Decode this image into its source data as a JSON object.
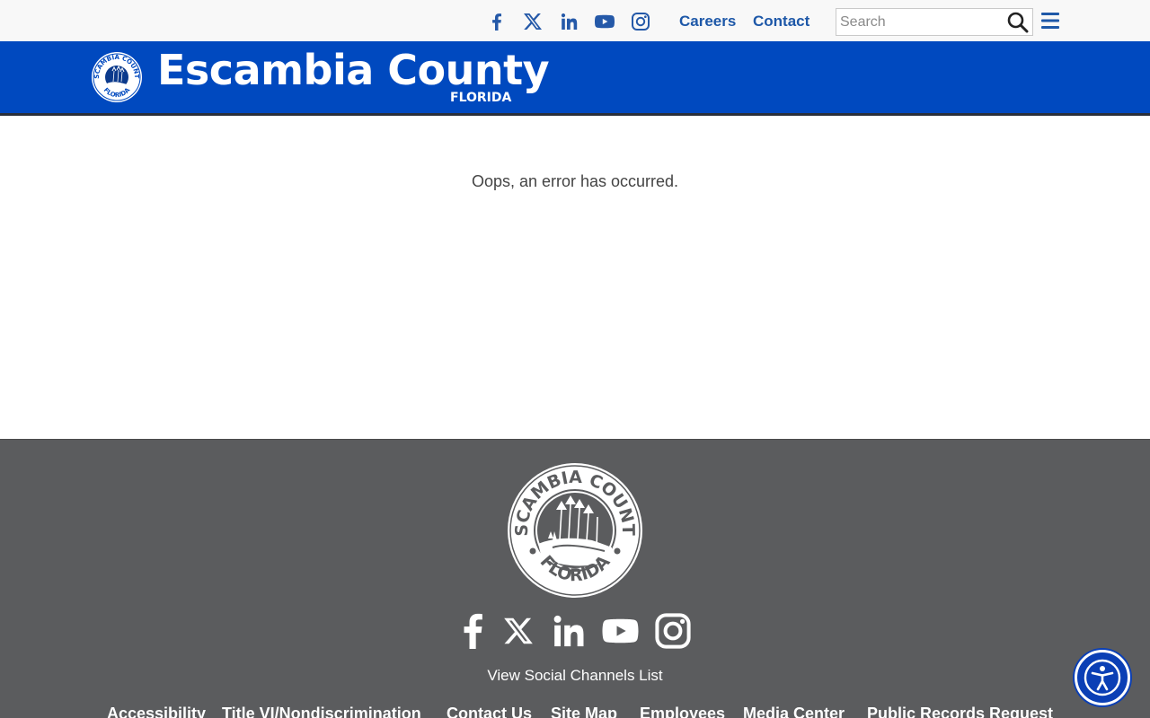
{
  "utility": {
    "social_icons": [
      "facebook-icon",
      "x-icon",
      "linkedin-icon",
      "youtube-icon",
      "instagram-icon"
    ],
    "links": [
      "Careers",
      "Contact"
    ],
    "search_placeholder": "Search"
  },
  "header": {
    "title": "Escambia County",
    "subtitle": "FLORIDA",
    "seal_text_top": "ESCAMBIA COUNTY",
    "seal_text_bottom": "FLORIDA"
  },
  "main": {
    "message": "Oops, an error has occurred."
  },
  "footer": {
    "social_icons": [
      "facebook-icon",
      "x-icon",
      "linkedin-icon",
      "youtube-icon",
      "instagram-icon"
    ],
    "channels_link": "View Social Channels List",
    "links": [
      "Accessibility",
      "Title VI/Nondiscrimination",
      "Contact Us",
      "Site Map",
      "Employees",
      "Media Center",
      "Public Records Request"
    ]
  },
  "colors": {
    "header_blue": "#0049bf",
    "link_blue": "#1e58a8",
    "footer_gray": "#5b5c5e",
    "accessibility_blue": "#0b3fb5"
  }
}
